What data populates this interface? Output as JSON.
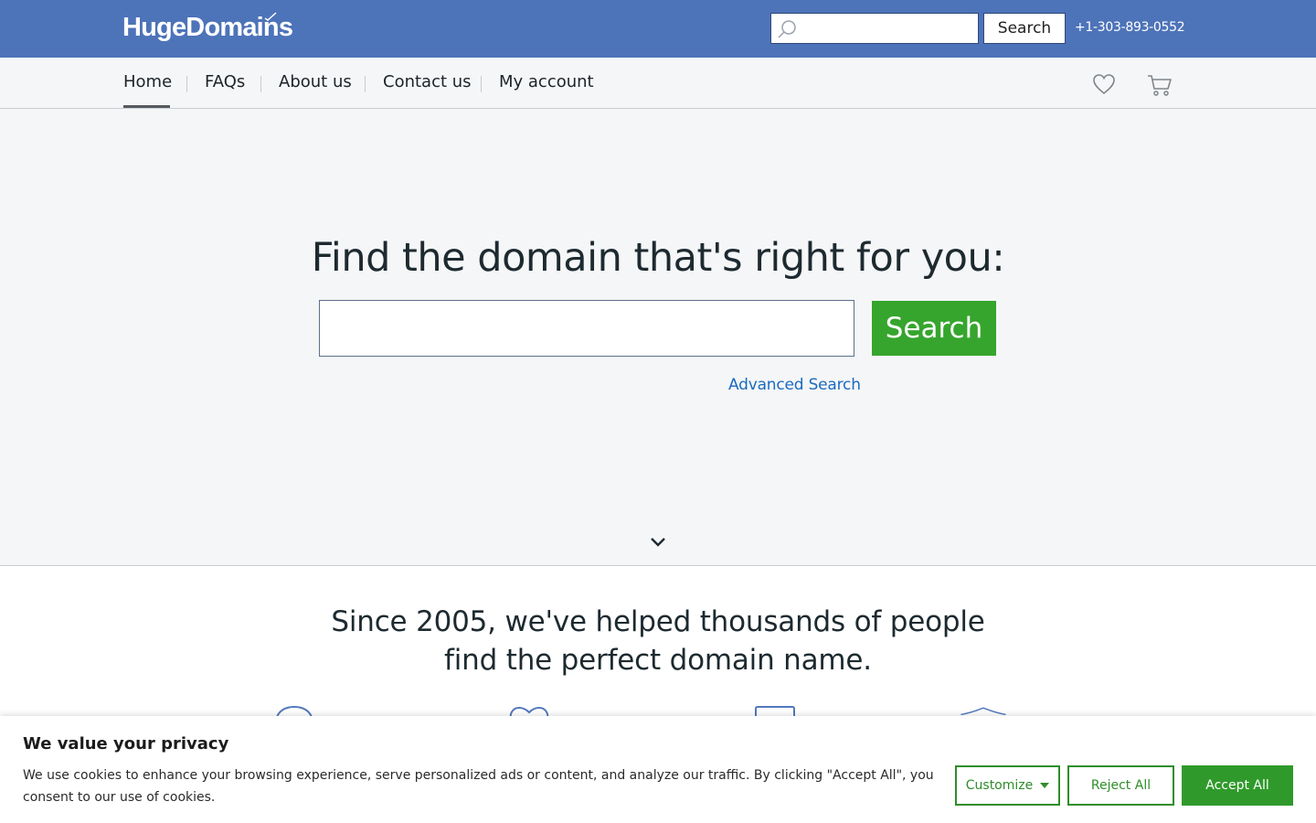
{
  "header": {
    "logo": "HugeDomains",
    "search_placeholder": "",
    "search_button": "Search",
    "phone": "+1-303-893-0552"
  },
  "nav": {
    "items": [
      {
        "label": "Home",
        "active": true
      },
      {
        "label": "FAQs"
      },
      {
        "label": "About us"
      },
      {
        "label": "Contact us"
      },
      {
        "label": "My account"
      }
    ],
    "icons": [
      "heart-icon",
      "cart-icon"
    ]
  },
  "hero": {
    "title": "Find the domain that's right for you:",
    "search_value": "",
    "search_button": "Search",
    "advanced_link": "Advanced Search"
  },
  "since": {
    "line1": "Since 2005, we've helped thousands of people",
    "line2": "find the perfect domain name."
  },
  "cookie": {
    "title": "We value your privacy",
    "text": "We use cookies to enhance your browsing experience, serve personalized ads or content, and analyze our traffic. By clicking \"Accept All\", you consent to our use of cookies.",
    "customize": "Customize",
    "reject": "Reject All",
    "accept": "Accept All"
  },
  "colors": {
    "header_bg": "#4d73b9",
    "accent_green": "#36a52d",
    "link_blue": "#1a6ac0",
    "hero_bg": "#f5f6f7"
  }
}
